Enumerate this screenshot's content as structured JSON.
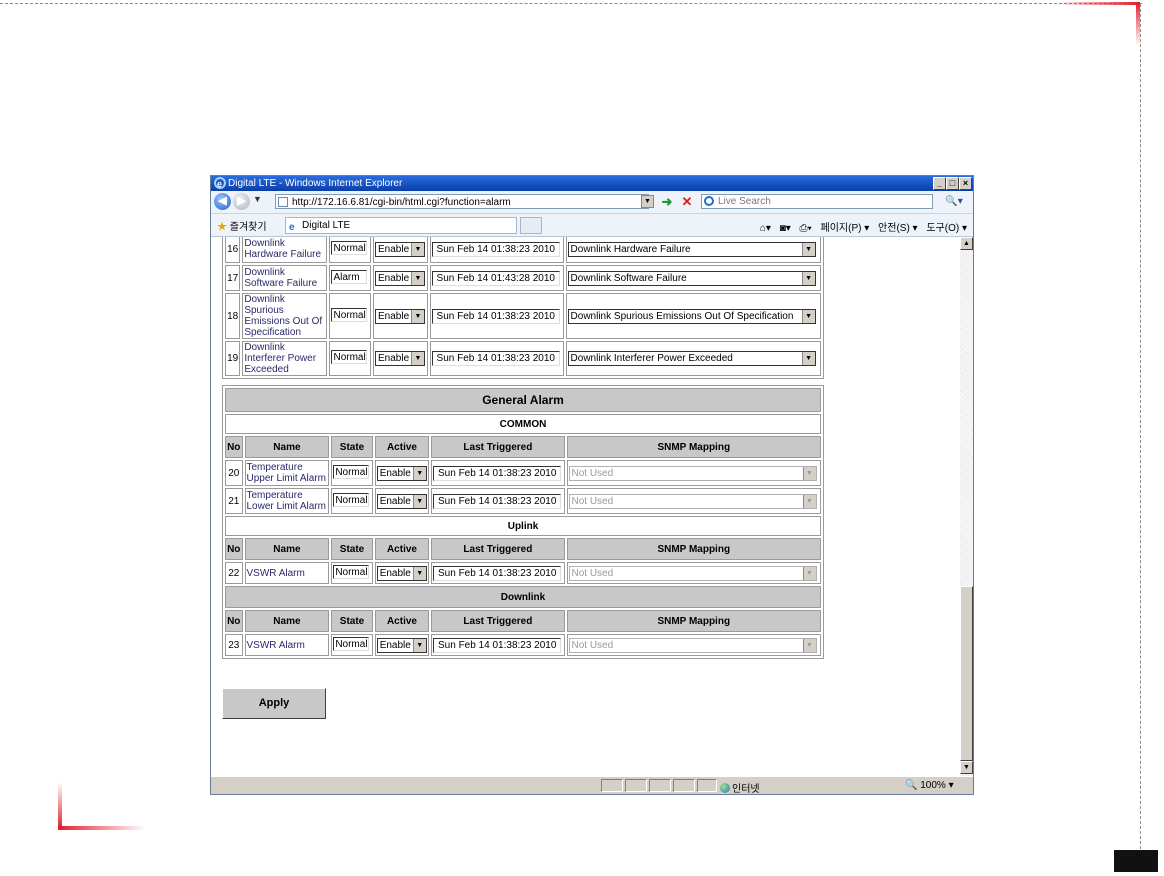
{
  "window": {
    "title": "Digital LTE - Windows Internet Explorer",
    "url": "http://172.16.6.81/cgi-bin/html.cgi?function=alarm",
    "search_placeholder": "Live Search",
    "favorites_label": "즐겨찾기",
    "tab_label": "Digital LTE",
    "commands": [
      "페이지(P) ▾",
      "안전(S) ▾",
      "도구(O) ▾"
    ],
    "status_zone": "인터넷",
    "zoom": "100%"
  },
  "top_table": {
    "rows": [
      {
        "no": "16",
        "name": "Downlink Hardware Failure",
        "state": "Normal",
        "active": "Enable",
        "last_triggered": "Sun Feb 14 01:38:23 2010",
        "snmp": "Downlink Hardware Failure"
      },
      {
        "no": "17",
        "name": "Downlink Software Failure",
        "state": "Alarm",
        "active": "Enable",
        "last_triggered": "Sun Feb 14 01:43:28 2010",
        "snmp": "Downlink Software Failure"
      },
      {
        "no": "18",
        "name": "Downlink Spurious Emissions Out Of Specification",
        "state": "Normal",
        "active": "Enable",
        "last_triggered": "Sun Feb 14 01:38:23 2010",
        "snmp": "Downlink Spurious Emissions Out Of Specification"
      },
      {
        "no": "19",
        "name": "Downlink Interferer Power Exceeded",
        "state": "Normal",
        "active": "Enable",
        "last_triggered": "Sun Feb 14 01:38:23 2010",
        "snmp": "Downlink Interferer Power Exceeded"
      }
    ]
  },
  "general": {
    "title": "General Alarm",
    "columns": [
      "No",
      "Name",
      "State",
      "Active",
      "Last Triggered",
      "SNMP Mapping"
    ],
    "sections": [
      {
        "label": "COMMON",
        "rows": [
          {
            "no": "20",
            "name": "Temperature Upper Limit Alarm",
            "state": "Normal",
            "active": "Enable",
            "last_triggered": "Sun Feb 14 01:38:23 2010",
            "snmp": "Not Used"
          },
          {
            "no": "21",
            "name": "Temperature Lower Limit Alarm",
            "state": "Normal",
            "active": "Enable",
            "last_triggered": "Sun Feb 14 01:38:23 2010",
            "snmp": "Not Used"
          }
        ]
      },
      {
        "label": "Uplink",
        "rows": [
          {
            "no": "22",
            "name": "VSWR Alarm",
            "state": "Normal",
            "active": "Enable",
            "last_triggered": "Sun Feb 14 01:38:23 2010",
            "snmp": "Not Used"
          }
        ]
      },
      {
        "label": "Downlink",
        "rows": [
          {
            "no": "23",
            "name": "VSWR Alarm",
            "state": "Normal",
            "active": "Enable",
            "last_triggered": "Sun Feb 14 01:38:23 2010",
            "snmp": "Not Used"
          }
        ]
      }
    ]
  },
  "apply_label": "Apply"
}
